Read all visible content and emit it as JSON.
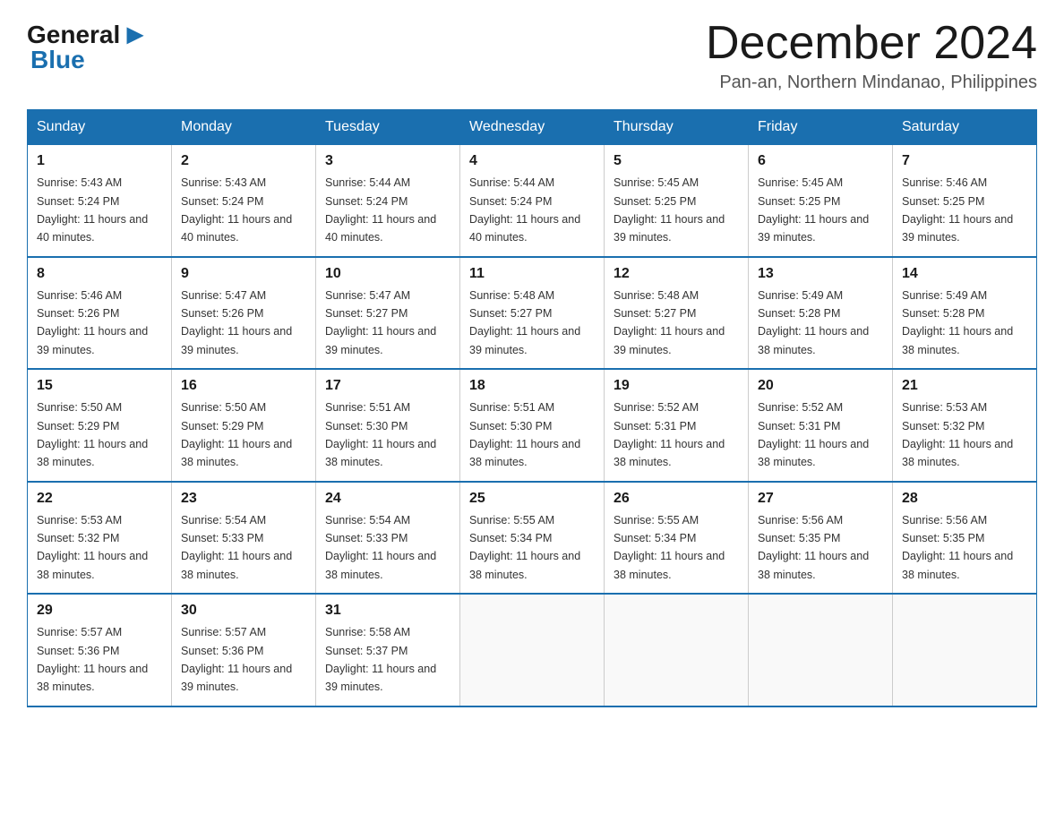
{
  "header": {
    "logo_general": "General",
    "logo_blue": "Blue",
    "month_title": "December 2024",
    "location": "Pan-an, Northern Mindanao, Philippines"
  },
  "weekdays": [
    "Sunday",
    "Monday",
    "Tuesday",
    "Wednesday",
    "Thursday",
    "Friday",
    "Saturday"
  ],
  "weeks": [
    [
      {
        "day": "1",
        "sunrise": "5:43 AM",
        "sunset": "5:24 PM",
        "daylight": "11 hours and 40 minutes."
      },
      {
        "day": "2",
        "sunrise": "5:43 AM",
        "sunset": "5:24 PM",
        "daylight": "11 hours and 40 minutes."
      },
      {
        "day": "3",
        "sunrise": "5:44 AM",
        "sunset": "5:24 PM",
        "daylight": "11 hours and 40 minutes."
      },
      {
        "day": "4",
        "sunrise": "5:44 AM",
        "sunset": "5:24 PM",
        "daylight": "11 hours and 40 minutes."
      },
      {
        "day": "5",
        "sunrise": "5:45 AM",
        "sunset": "5:25 PM",
        "daylight": "11 hours and 39 minutes."
      },
      {
        "day": "6",
        "sunrise": "5:45 AM",
        "sunset": "5:25 PM",
        "daylight": "11 hours and 39 minutes."
      },
      {
        "day": "7",
        "sunrise": "5:46 AM",
        "sunset": "5:25 PM",
        "daylight": "11 hours and 39 minutes."
      }
    ],
    [
      {
        "day": "8",
        "sunrise": "5:46 AM",
        "sunset": "5:26 PM",
        "daylight": "11 hours and 39 minutes."
      },
      {
        "day": "9",
        "sunrise": "5:47 AM",
        "sunset": "5:26 PM",
        "daylight": "11 hours and 39 minutes."
      },
      {
        "day": "10",
        "sunrise": "5:47 AM",
        "sunset": "5:27 PM",
        "daylight": "11 hours and 39 minutes."
      },
      {
        "day": "11",
        "sunrise": "5:48 AM",
        "sunset": "5:27 PM",
        "daylight": "11 hours and 39 minutes."
      },
      {
        "day": "12",
        "sunrise": "5:48 AM",
        "sunset": "5:27 PM",
        "daylight": "11 hours and 39 minutes."
      },
      {
        "day": "13",
        "sunrise": "5:49 AM",
        "sunset": "5:28 PM",
        "daylight": "11 hours and 38 minutes."
      },
      {
        "day": "14",
        "sunrise": "5:49 AM",
        "sunset": "5:28 PM",
        "daylight": "11 hours and 38 minutes."
      }
    ],
    [
      {
        "day": "15",
        "sunrise": "5:50 AM",
        "sunset": "5:29 PM",
        "daylight": "11 hours and 38 minutes."
      },
      {
        "day": "16",
        "sunrise": "5:50 AM",
        "sunset": "5:29 PM",
        "daylight": "11 hours and 38 minutes."
      },
      {
        "day": "17",
        "sunrise": "5:51 AM",
        "sunset": "5:30 PM",
        "daylight": "11 hours and 38 minutes."
      },
      {
        "day": "18",
        "sunrise": "5:51 AM",
        "sunset": "5:30 PM",
        "daylight": "11 hours and 38 minutes."
      },
      {
        "day": "19",
        "sunrise": "5:52 AM",
        "sunset": "5:31 PM",
        "daylight": "11 hours and 38 minutes."
      },
      {
        "day": "20",
        "sunrise": "5:52 AM",
        "sunset": "5:31 PM",
        "daylight": "11 hours and 38 minutes."
      },
      {
        "day": "21",
        "sunrise": "5:53 AM",
        "sunset": "5:32 PM",
        "daylight": "11 hours and 38 minutes."
      }
    ],
    [
      {
        "day": "22",
        "sunrise": "5:53 AM",
        "sunset": "5:32 PM",
        "daylight": "11 hours and 38 minutes."
      },
      {
        "day": "23",
        "sunrise": "5:54 AM",
        "sunset": "5:33 PM",
        "daylight": "11 hours and 38 minutes."
      },
      {
        "day": "24",
        "sunrise": "5:54 AM",
        "sunset": "5:33 PM",
        "daylight": "11 hours and 38 minutes."
      },
      {
        "day": "25",
        "sunrise": "5:55 AM",
        "sunset": "5:34 PM",
        "daylight": "11 hours and 38 minutes."
      },
      {
        "day": "26",
        "sunrise": "5:55 AM",
        "sunset": "5:34 PM",
        "daylight": "11 hours and 38 minutes."
      },
      {
        "day": "27",
        "sunrise": "5:56 AM",
        "sunset": "5:35 PM",
        "daylight": "11 hours and 38 minutes."
      },
      {
        "day": "28",
        "sunrise": "5:56 AM",
        "sunset": "5:35 PM",
        "daylight": "11 hours and 38 minutes."
      }
    ],
    [
      {
        "day": "29",
        "sunrise": "5:57 AM",
        "sunset": "5:36 PM",
        "daylight": "11 hours and 38 minutes."
      },
      {
        "day": "30",
        "sunrise": "5:57 AM",
        "sunset": "5:36 PM",
        "daylight": "11 hours and 39 minutes."
      },
      {
        "day": "31",
        "sunrise": "5:58 AM",
        "sunset": "5:37 PM",
        "daylight": "11 hours and 39 minutes."
      },
      null,
      null,
      null,
      null
    ]
  ]
}
